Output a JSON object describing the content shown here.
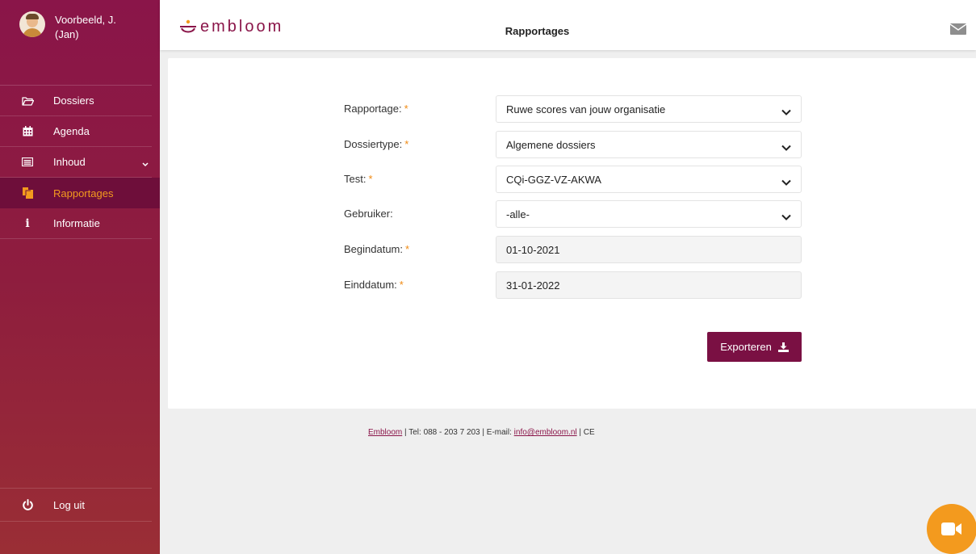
{
  "user": {
    "name": "Voorbeeld, J. (Jan)"
  },
  "nav": {
    "items": [
      {
        "label": "Dossiers",
        "icon": "folder-icon"
      },
      {
        "label": "Agenda",
        "icon": "calendar-icon"
      },
      {
        "label": "Inhoud",
        "icon": "content-icon"
      },
      {
        "label": "Rapportages",
        "icon": "reports-icon"
      },
      {
        "label": "Informatie",
        "icon": "info-icon"
      }
    ],
    "logout": "Log uit"
  },
  "header": {
    "logo": "embloom",
    "title": "Rapportages"
  },
  "form": {
    "rapportage": {
      "label": "Rapportage:",
      "value": "Ruwe scores van jouw organisatie",
      "required": "*"
    },
    "dossiertype": {
      "label": "Dossiertype:",
      "value": "Algemene dossiers",
      "required": "*"
    },
    "test": {
      "label": "Test:",
      "value": "CQi-GGZ-VZ-AKWA",
      "required": "*"
    },
    "gebruiker": {
      "label": "Gebruiker:",
      "value": "-alle-"
    },
    "begindatum": {
      "label": "Begindatum:",
      "value": "01-10-2021",
      "required": "*"
    },
    "einddatum": {
      "label": "Einddatum:",
      "value": "31-01-2022",
      "required": "*"
    },
    "export_label": "Exporteren"
  },
  "footer": {
    "company": "Embloom",
    "tel": " | Tel: 088 - 203 7 203 | E-mail: ",
    "email": "info@embloom.nl",
    "ce": " | CE"
  },
  "colors": {
    "brand": "#8a1549",
    "accent": "#f39a1e",
    "button": "#7a1043"
  }
}
